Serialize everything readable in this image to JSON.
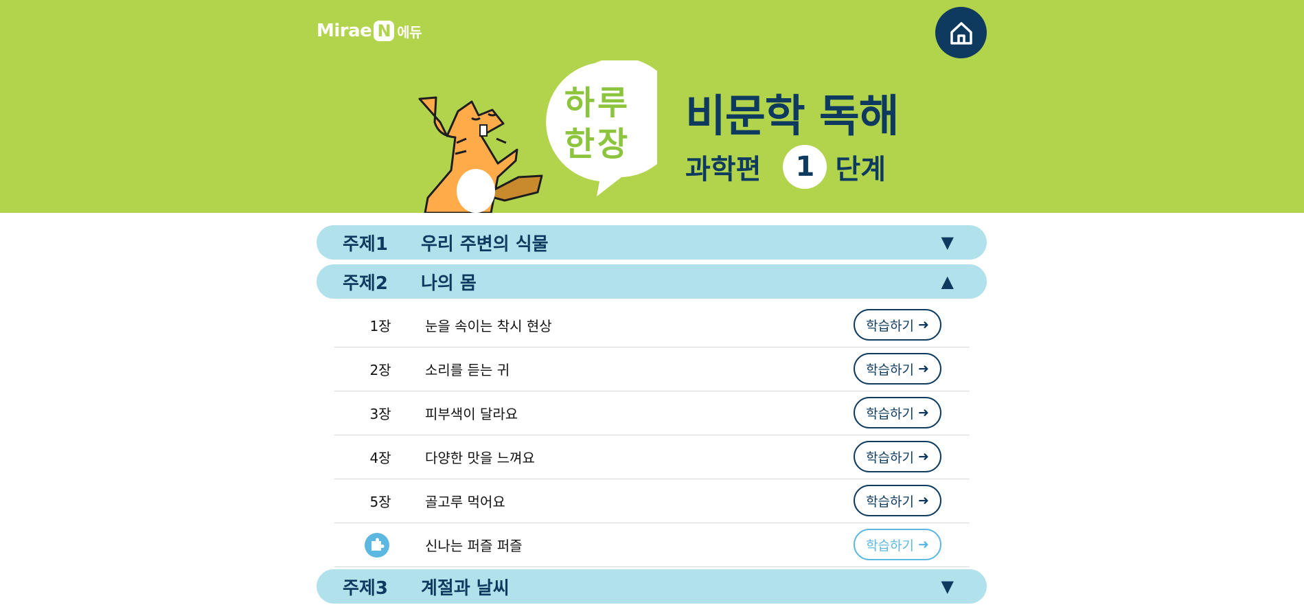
{
  "header": {
    "logo_brand": "Mirae",
    "logo_n": "N",
    "logo_edu": "에듀",
    "home_icon": "home-icon",
    "bubble_line1": "하루",
    "bubble_line2": "한장",
    "title": "비문학 독해",
    "subject": "과학편",
    "level": "1",
    "level_suffix": "단계"
  },
  "colors": {
    "banner": "#b2d44c",
    "navy": "#0d3a5e",
    "topic_bar": "#b1e2ec",
    "puzzle_blue": "#5cb8e0"
  },
  "topics": [
    {
      "num": "주제1",
      "title": "우리 주변의 식물",
      "arrow": "▼"
    },
    {
      "num": "주제2",
      "title": "나의 몸",
      "arrow": "▲"
    },
    {
      "num": "주제3",
      "title": "계절과 날씨",
      "arrow": "▼"
    }
  ],
  "chapters": [
    {
      "num": "1장",
      "title": "눈을 속이는 착시 현상",
      "button": "학습하기",
      "arrow": "➜"
    },
    {
      "num": "2장",
      "title": "소리를 듣는 귀",
      "button": "학습하기",
      "arrow": "➜"
    },
    {
      "num": "3장",
      "title": "피부색이 달라요",
      "button": "학습하기",
      "arrow": "➜"
    },
    {
      "num": "4장",
      "title": "다양한 맛을 느껴요",
      "button": "학습하기",
      "arrow": "➜"
    },
    {
      "num": "5장",
      "title": "골고루 먹어요",
      "button": "학습하기",
      "arrow": "➜"
    },
    {
      "icon": "puzzle-icon",
      "title": "신나는 퍼즐 퍼즐",
      "button": "학습하기",
      "arrow": "➜"
    }
  ]
}
